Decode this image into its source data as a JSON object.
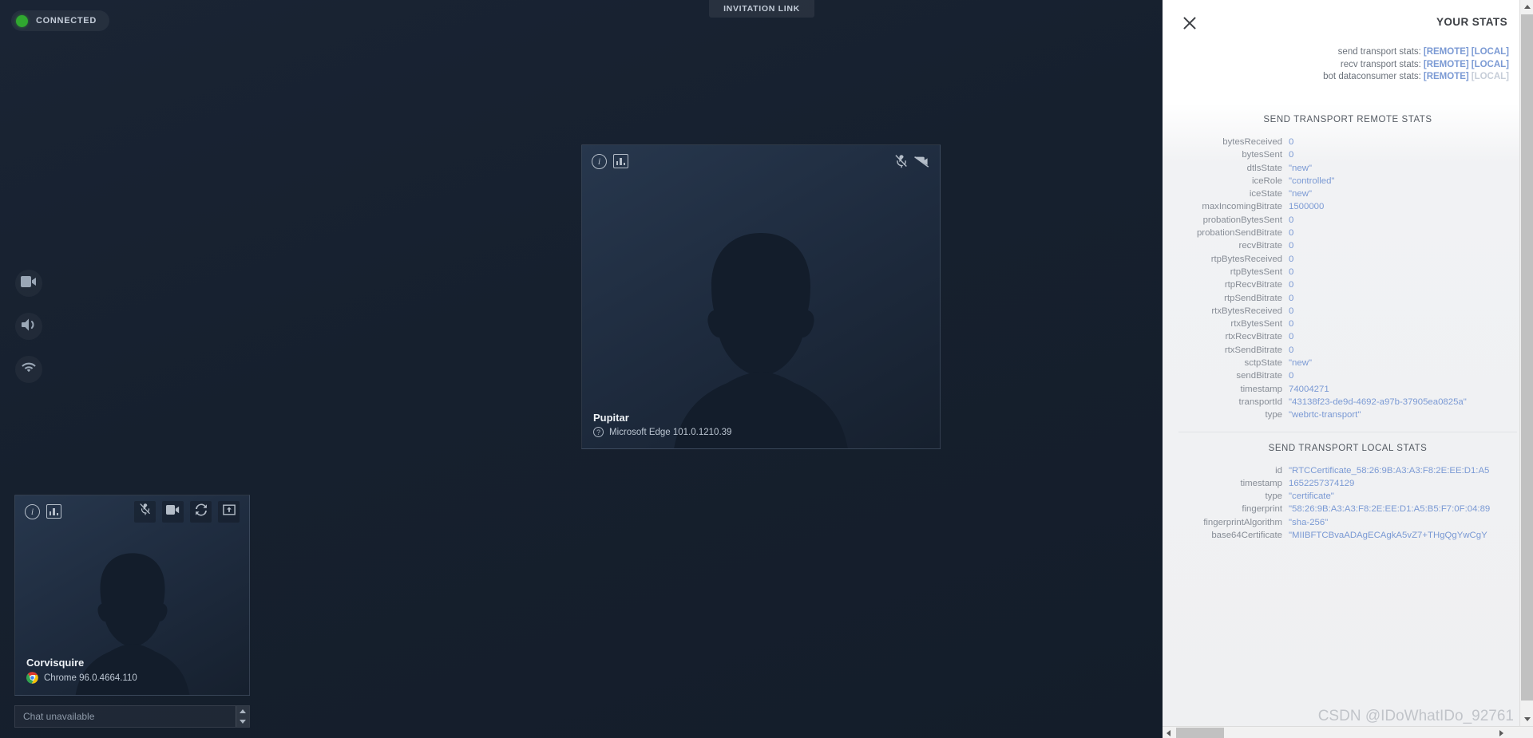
{
  "room": {
    "status_badge": {
      "label": "CONNECTED",
      "dot_color": "#30a830"
    },
    "invitation_link": {
      "label": "INVITATION LINK"
    },
    "rail": [
      {
        "name": "webcam-icon",
        "label": "webcam"
      },
      {
        "name": "audio-icon",
        "label": "audio"
      },
      {
        "name": "network-icon",
        "label": "network"
      }
    ],
    "peer_tile": {
      "name": "Pupitar",
      "device": "Microsoft Edge 101.0.1210.39",
      "device_icon": "question-mark-icon",
      "toolbar_left": [
        "info-icon",
        "stats-icon"
      ],
      "toolbar_right": [
        "mic-muted-icon",
        "camera-off-icon"
      ]
    },
    "local_tile": {
      "name": "Corvisquire",
      "device": "Chrome 96.0.4664.110",
      "device_icon": "chrome-logo-icon",
      "toolbar_left": [
        "info-icon",
        "stats-icon"
      ],
      "toolbar_right": [
        "mic-muted-button",
        "camera-button",
        "change-webcam-button",
        "share-screen-button"
      ]
    },
    "chat": {
      "placeholder": "Chat unavailable",
      "value": ""
    }
  },
  "stats_panel": {
    "title": "YOUR STATS",
    "close_label": "×",
    "links": [
      {
        "label": "send transport stats:",
        "remote": "[REMOTE]",
        "local": "[LOCAL]",
        "local_disabled": false
      },
      {
        "label": "recv transport stats:",
        "remote": "[REMOTE]",
        "local": "[LOCAL]",
        "local_disabled": false
      },
      {
        "label": "bot dataconsumer stats:",
        "remote": "[REMOTE]",
        "local": "[LOCAL]",
        "local_disabled": true
      }
    ],
    "sections": [
      {
        "title": "SEND TRANSPORT REMOTE STATS",
        "rows": [
          {
            "key": "bytesReceived",
            "value": "0"
          },
          {
            "key": "bytesSent",
            "value": "0"
          },
          {
            "key": "dtlsState",
            "value": "\"new\""
          },
          {
            "key": "iceRole",
            "value": "\"controlled\""
          },
          {
            "key": "iceState",
            "value": "\"new\""
          },
          {
            "key": "maxIncomingBitrate",
            "value": "1500000"
          },
          {
            "key": "probationBytesSent",
            "value": "0"
          },
          {
            "key": "probationSendBitrate",
            "value": "0"
          },
          {
            "key": "recvBitrate",
            "value": "0"
          },
          {
            "key": "rtpBytesReceived",
            "value": "0"
          },
          {
            "key": "rtpBytesSent",
            "value": "0"
          },
          {
            "key": "rtpRecvBitrate",
            "value": "0"
          },
          {
            "key": "rtpSendBitrate",
            "value": "0"
          },
          {
            "key": "rtxBytesReceived",
            "value": "0"
          },
          {
            "key": "rtxBytesSent",
            "value": "0"
          },
          {
            "key": "rtxRecvBitrate",
            "value": "0"
          },
          {
            "key": "rtxSendBitrate",
            "value": "0"
          },
          {
            "key": "sctpState",
            "value": "\"new\""
          },
          {
            "key": "sendBitrate",
            "value": "0"
          },
          {
            "key": "timestamp",
            "value": "74004271"
          },
          {
            "key": "transportId",
            "value": "\"43138f23-de9d-4692-a97b-37905ea0825a\""
          },
          {
            "key": "type",
            "value": "\"webrtc-transport\""
          }
        ]
      },
      {
        "title": "SEND TRANSPORT LOCAL STATS",
        "rows": [
          {
            "key": "id",
            "value": "\"RTCCertificate_58:26:9B:A3:A3:F8:2E:EE:D1:A5"
          },
          {
            "key": "timestamp",
            "value": "1652257374129"
          },
          {
            "key": "type",
            "value": "\"certificate\""
          },
          {
            "key": "fingerprint",
            "value": "\"58:26:9B:A3:A3:F8:2E:EE:D1:A5:B5:F7:0F:04:89"
          },
          {
            "key": "fingerprintAlgorithm",
            "value": "\"sha-256\""
          },
          {
            "key": "base64Certificate",
            "value": "\"MIIBFTCBvaADAgECAgkA5vZ7+THgQgYwCgY"
          }
        ]
      }
    ],
    "watermark": "CSDN @IDoWhatIDo_92761",
    "colors": {
      "link": "#7b9ad4",
      "key": "#878d96",
      "title": "#3d4045"
    }
  }
}
